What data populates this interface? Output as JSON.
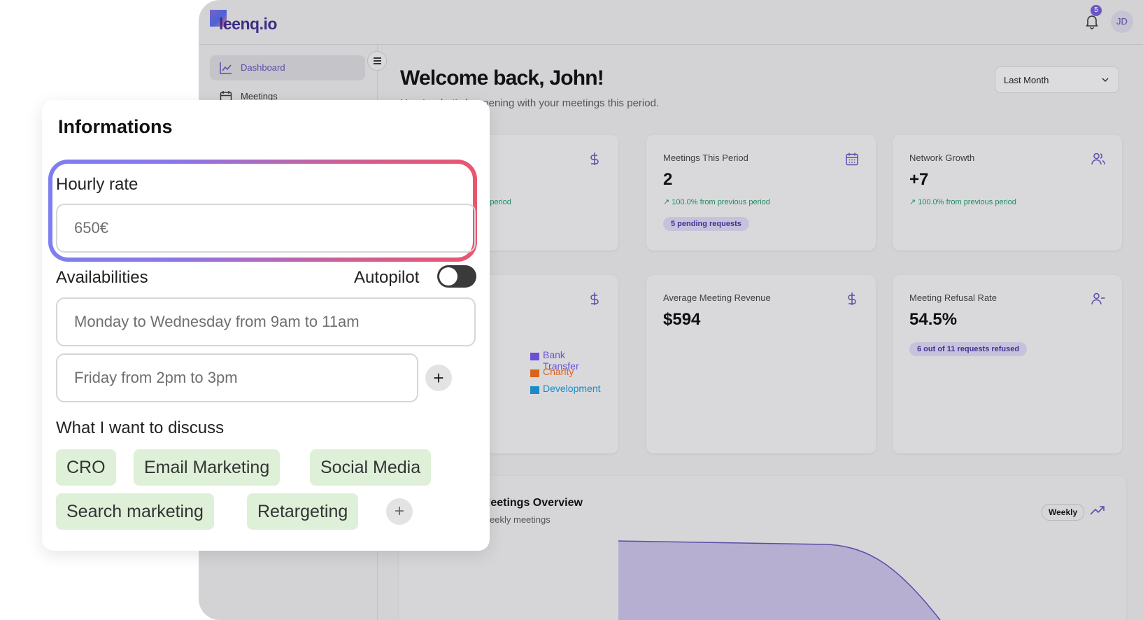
{
  "app": {
    "logo_text": "leenq.io",
    "notification_count": "5",
    "user_initials": "JD"
  },
  "sidebar": {
    "items": [
      {
        "label": "Dashboard",
        "icon": "line-chart-icon",
        "active": true
      },
      {
        "label": "Meetings",
        "icon": "calendar-icon"
      }
    ]
  },
  "header": {
    "welcome": "Welcome back, John!",
    "subtitle": "Here's what's happening with your meetings this period.",
    "period": "Last Month"
  },
  "cards": {
    "row1": [
      {
        "title": "",
        "value": "",
        "trend": "↗ 100.0% from previous period",
        "icon": "dollar-icon"
      },
      {
        "title": "Meetings This Period",
        "value": "2",
        "trend": "↗ 100.0% from previous period",
        "pill": "5 pending requests",
        "icon": "calendar-icon"
      },
      {
        "title": "Network Growth",
        "value": "+7",
        "trend": "↗ 100.0% from previous period",
        "icon": "users-icon"
      }
    ],
    "row2": [
      {
        "title": "",
        "value": "",
        "icon": "dollar-icon"
      },
      {
        "title": "Average Meeting Revenue",
        "value": "$594",
        "icon": "dollar-icon"
      },
      {
        "title": "Meeting Refusal Rate",
        "value": "54.5%",
        "pill": "6 out of 11 requests refused",
        "icon": "user-minus-icon"
      }
    ]
  },
  "revenue_legend": [
    {
      "label": "Bank Transfer",
      "color": "#6b4fd8"
    },
    {
      "label": "Charity",
      "color": "#d9641e"
    },
    {
      "label": "Development",
      "color": "#1a8ac9"
    }
  ],
  "overview": {
    "title": "Meetings Overview",
    "subtitle": "Weekly meetings",
    "period_button": "Weekly"
  },
  "info_panel": {
    "title": "Informations",
    "hourly_rate_label": "Hourly rate",
    "hourly_rate_value": "650€",
    "availabilities_label": "Availabilities",
    "autopilot_label": "Autopilot",
    "autopilot_on": false,
    "availability_slots": [
      "Monday to Wednesday from 9am to 11am",
      "Friday from 2pm to 3pm"
    ],
    "discuss_label": "What I want to discuss",
    "topics": [
      "CRO",
      "Email Marketing",
      "Social Media",
      "Search marketing",
      "Retargeting"
    ]
  },
  "colors": {
    "accent": "#5b4ca8",
    "trend_up": "#1a8d5f",
    "tag_bg": "#dff0d9"
  }
}
